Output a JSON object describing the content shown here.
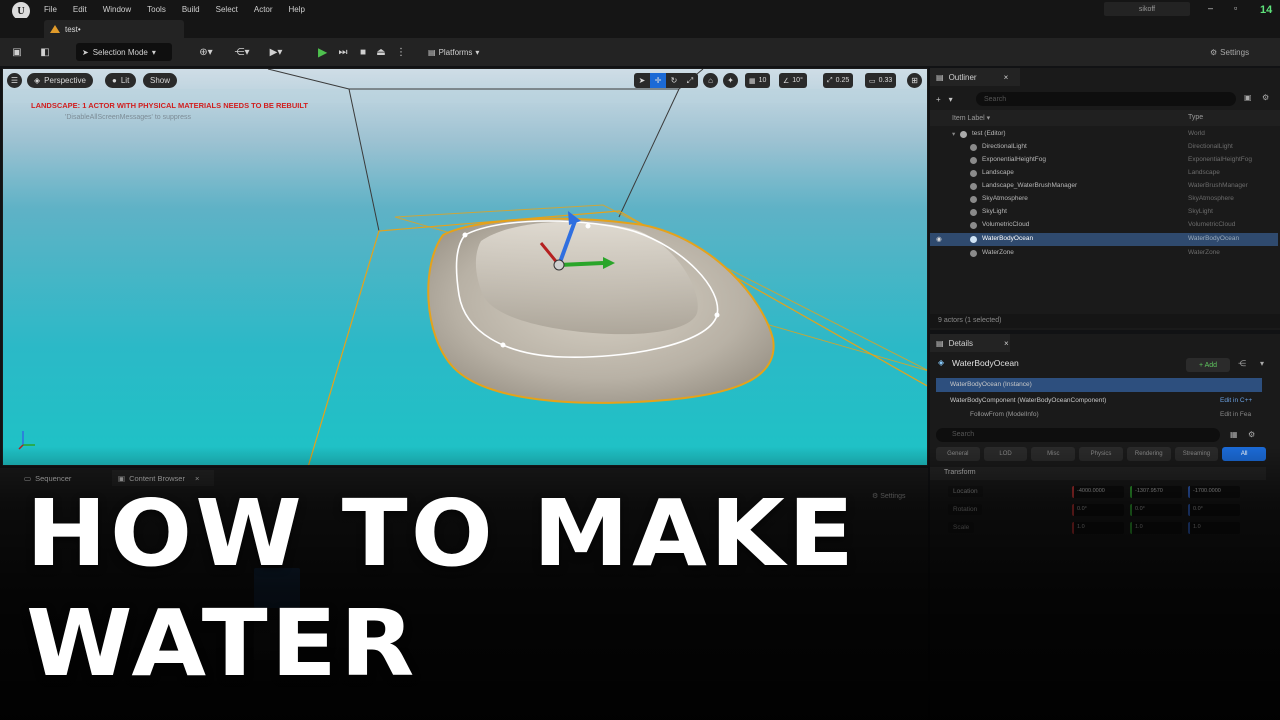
{
  "menubar": {
    "logo": "U",
    "items": [
      "File",
      "Edit",
      "Window",
      "Tools",
      "Build",
      "Select",
      "Actor",
      "Help"
    ],
    "user": "sikoff",
    "badge": "14"
  },
  "level_tab": {
    "label": "test•"
  },
  "toolbar": {
    "selection_mode": "Selection Mode",
    "platforms": "Platforms",
    "settings": "Settings"
  },
  "viewport": {
    "perspective": "Perspective",
    "lit": "Lit",
    "show": "Show",
    "grid_snap": "10",
    "rot_snap": "10°",
    "scale_snap": "0.25",
    "camera_speed": "0.33",
    "warning": "LANDSCAPE: 1 ACTOR WITH PHYSICAL MATERIALS NEEDS TO BE REBUILT",
    "warning_sub": "'DisableAllScreenMessages' to suppress",
    "colors": {
      "water_top": "#7fb4c8",
      "water_mid": "#2fb5c6",
      "water_near": "#1fc2c8",
      "sand": "#b7b0a6",
      "selection": "#e5a21a"
    }
  },
  "outliner": {
    "tab": "Outliner",
    "search_placeholder": "Search",
    "col_label": "Item Label ▾",
    "col_type": "Type",
    "rows": [
      {
        "label": "test (Editor)",
        "type": "World"
      },
      {
        "label": "DirectionalLight",
        "type": "DirectionalLight"
      },
      {
        "label": "ExponentialHeightFog",
        "type": "ExponentialHeightFog"
      },
      {
        "label": "Landscape",
        "type": "Landscape"
      },
      {
        "label": "Landscape_WaterBrushManager",
        "type": "WaterBrushManager"
      },
      {
        "label": "SkyAtmosphere",
        "type": "SkyAtmosphere"
      },
      {
        "label": "SkyLight",
        "type": "SkyLight"
      },
      {
        "label": "VolumetricCloud",
        "type": "VolumetricCloud"
      },
      {
        "label": "WaterBodyOcean",
        "type": "WaterBodyOcean"
      },
      {
        "label": "WaterZone",
        "type": "WaterZone"
      }
    ],
    "actor_count": "9 actors (1 selected)"
  },
  "details": {
    "tab": "Details",
    "title": "WaterBodyOcean",
    "add": "+ Add",
    "components": [
      {
        "label": "WaterBodyOcean (Instance)",
        "extra": ""
      },
      {
        "label": "WaterBodyComponent (WaterBodyOceanComponent)",
        "extra": "Edit in C++"
      },
      {
        "label": "FollowFrom (ModelInfo)",
        "extra": "Edit in Fea"
      }
    ],
    "search_placeholder": "Search",
    "filters": [
      "General",
      "LOD",
      "Misc",
      "Physics",
      "Rendering",
      "Streaming",
      "All"
    ],
    "transform_header": "Transform",
    "props": [
      {
        "name": "Location",
        "x": "-4000.0000",
        "y": "-1307.9570",
        "z": "-1700.0000"
      },
      {
        "name": "Rotation",
        "x": "0.0°",
        "y": "0.0°",
        "z": "0.0°"
      },
      {
        "name": "Scale",
        "x": "1.0",
        "y": "1.0",
        "z": "1.0"
      }
    ]
  },
  "bottom": {
    "tabs": [
      "Sequencer",
      "Content Browser"
    ],
    "settings": "Settings"
  },
  "title": {
    "line1": "HOW TO MAKE",
    "line2": "WATER"
  }
}
